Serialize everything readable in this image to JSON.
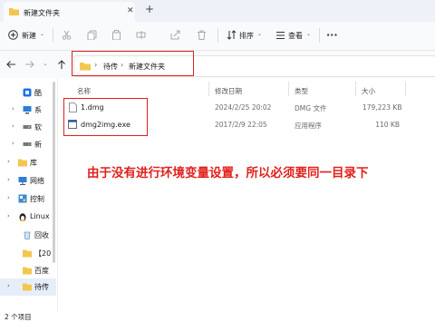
{
  "window": {
    "tab_title": "新建文件夹",
    "close_glyph": "✕",
    "new_tab_glyph": "+"
  },
  "toolbar": {
    "new_label": "新建",
    "sort_label": "排序",
    "view_label": "查看",
    "more_glyph": "···"
  },
  "address": {
    "crumbs": [
      "待传",
      "新建文件夹"
    ]
  },
  "nav_pane": {
    "items": [
      {
        "label": "酷",
        "icon": "app-icon"
      },
      {
        "label": "系",
        "icon": "pc-icon"
      },
      {
        "label": "软",
        "icon": "drive-icon"
      },
      {
        "label": "新",
        "icon": "drive-icon"
      },
      {
        "label": "库",
        "icon": "library-icon"
      },
      {
        "label": "网络",
        "icon": "network-icon"
      },
      {
        "label": "控制",
        "icon": "control-panel-icon"
      },
      {
        "label": "Linux",
        "icon": "linux-icon"
      },
      {
        "label": "回收",
        "icon": "recycle-bin-icon"
      },
      {
        "label": "【20",
        "icon": "folder-icon"
      },
      {
        "label": "百度",
        "icon": "folder-icon"
      },
      {
        "label": "待传",
        "icon": "folder-icon"
      }
    ]
  },
  "file_list": {
    "columns": [
      "名称",
      "修改日期",
      "类型",
      "大小"
    ],
    "rows": [
      {
        "name": "1.dmg",
        "modified": "2024/2/25 20:02",
        "type": "DMG 文件",
        "size": "179,223 KB",
        "icon": "file-icon"
      },
      {
        "name": "dmg2img.exe",
        "modified": "2017/2/9 22:05",
        "type": "应用程序",
        "size": "110 KB",
        "icon": "exe-icon"
      }
    ]
  },
  "annotation_text": "由于没有进行环境变量设置，所以必须要同一目录下",
  "status": {
    "item_count": "2 个项目"
  },
  "colors": {
    "annotation": "#e0201c",
    "folder": "#f4c64e",
    "accent": "#0067c0"
  }
}
